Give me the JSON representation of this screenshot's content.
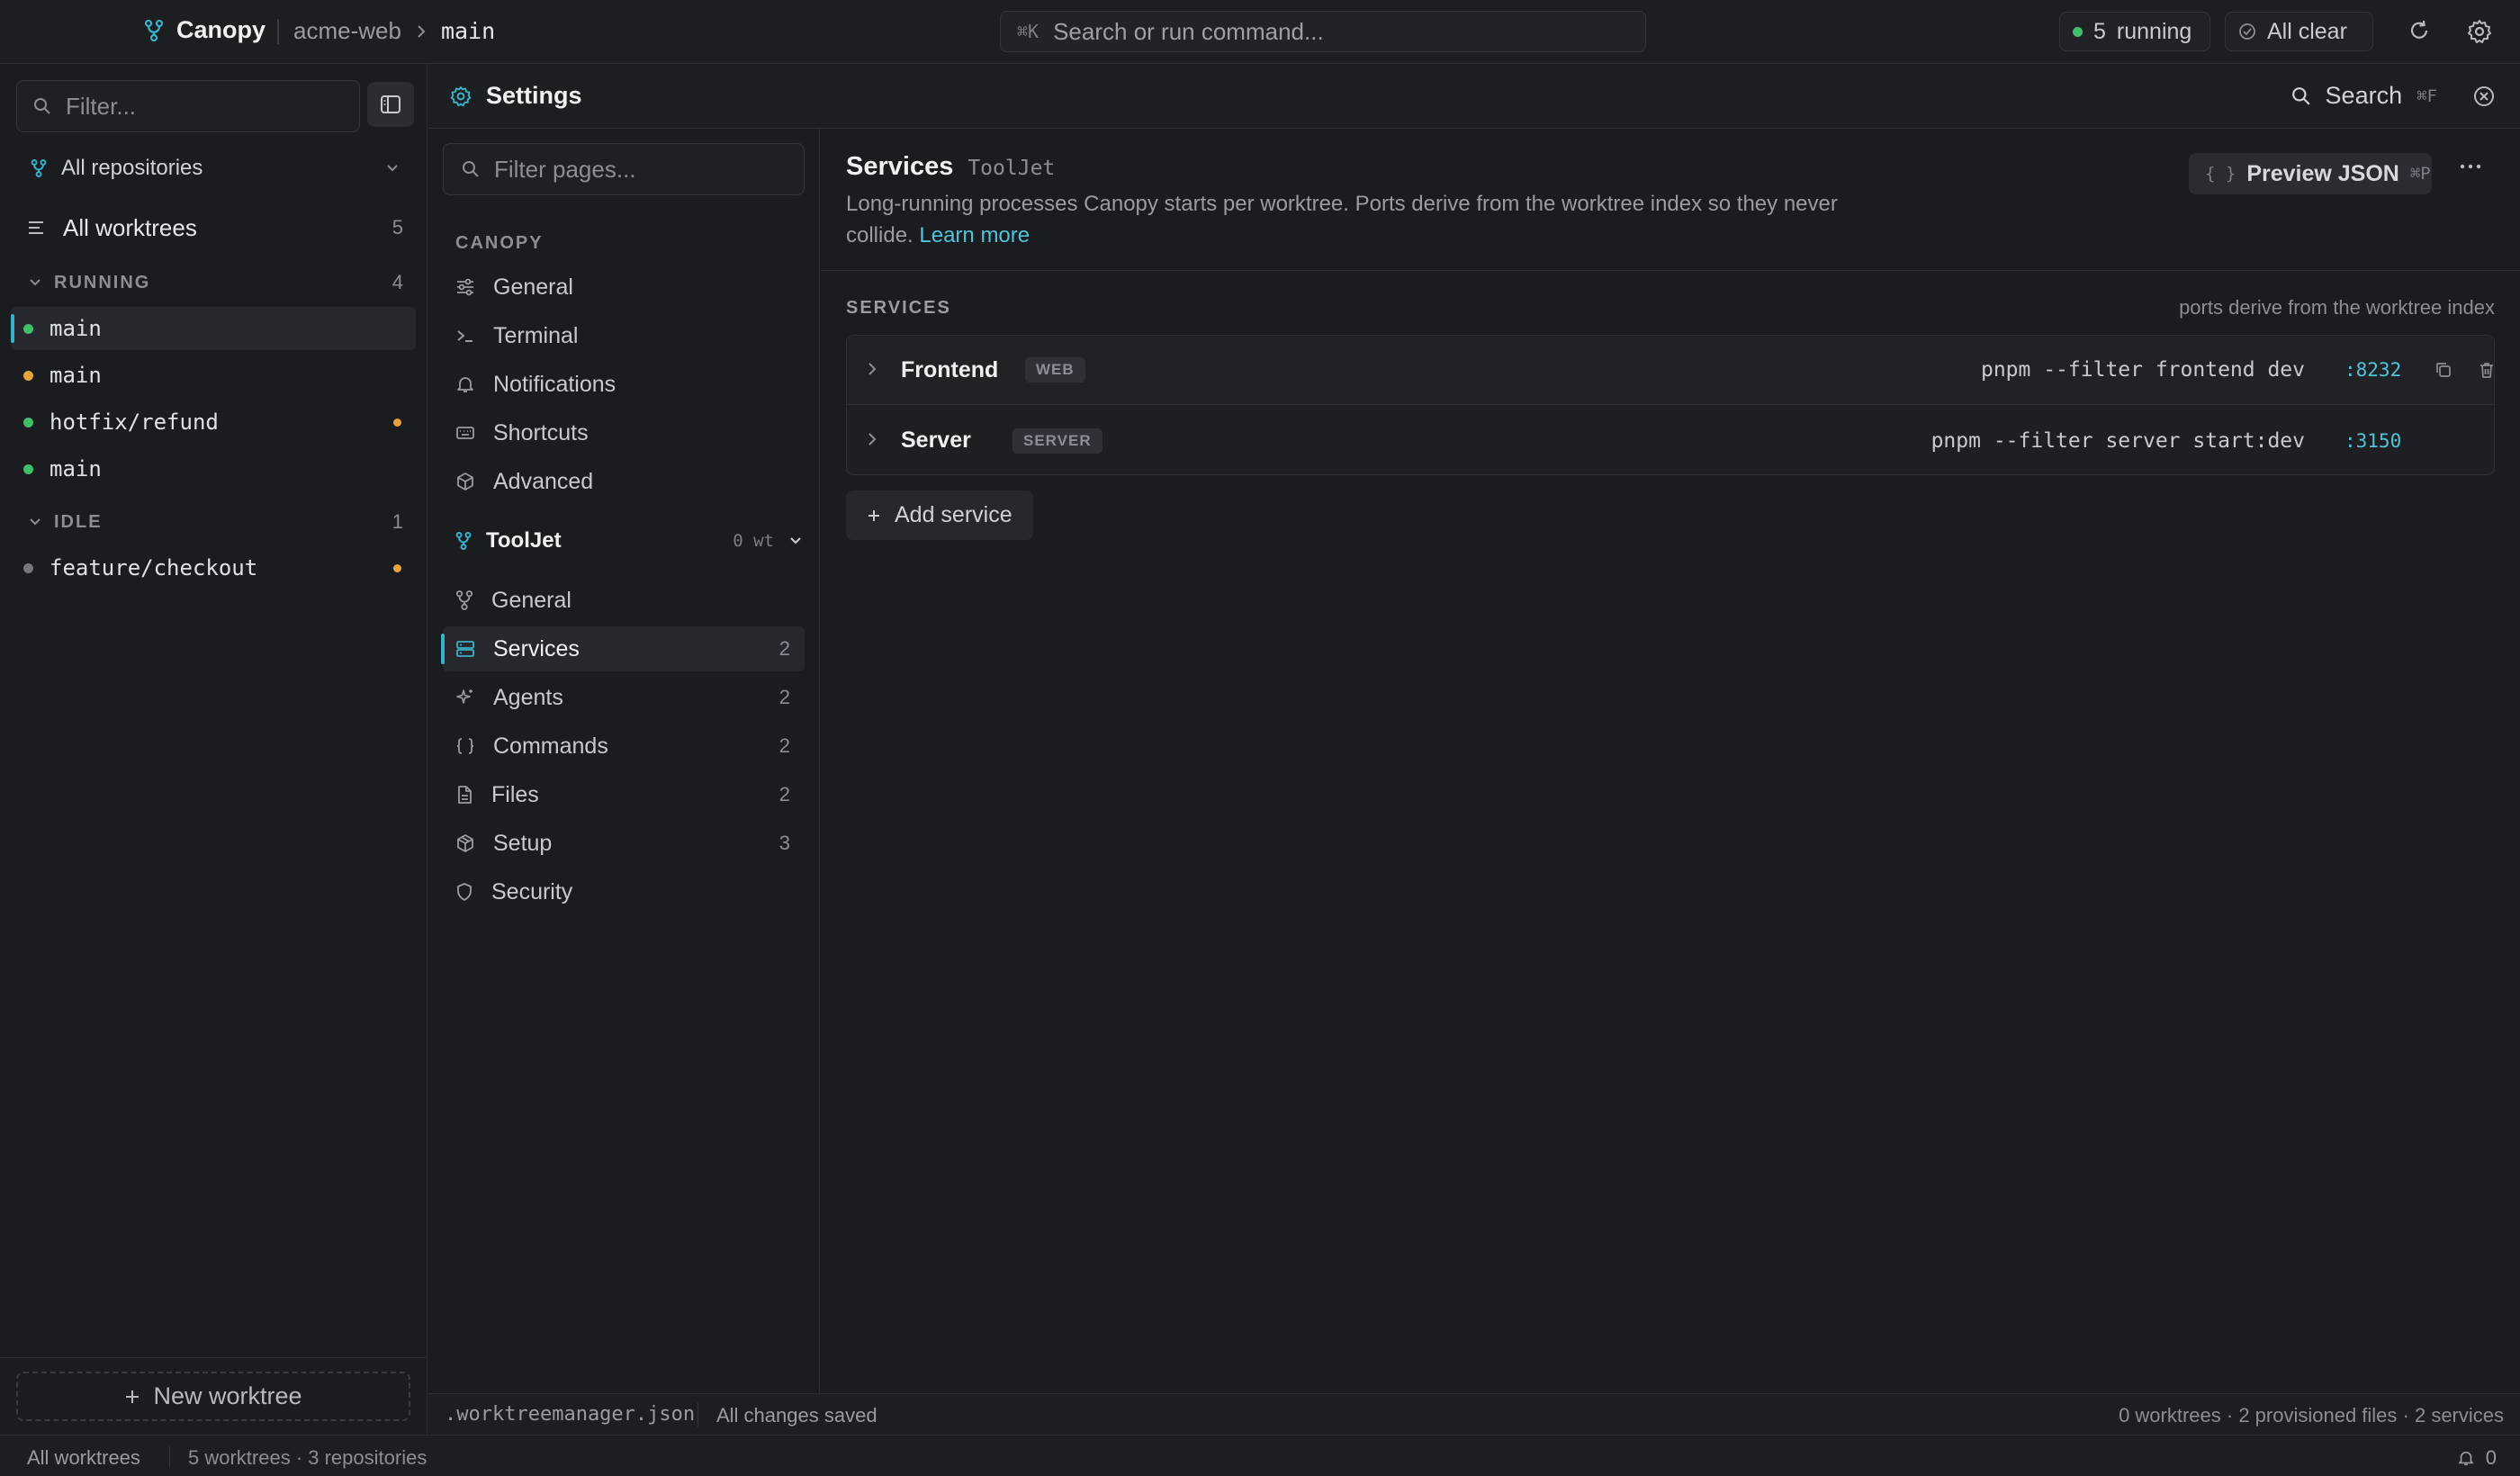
{
  "topbar": {
    "app_name": "Canopy",
    "repo": "acme-web",
    "branch": "main",
    "command_kbd": "⌘K",
    "command_placeholder": "Search or run command...",
    "running_count": "5",
    "running_label": "running",
    "status_label": "All clear"
  },
  "sidebar": {
    "filter_placeholder": "Filter...",
    "repo_select": "All repositories",
    "all_worktrees": {
      "label": "All worktrees",
      "count": "5"
    },
    "groups": [
      {
        "label": "RUNNING",
        "count": "4",
        "items": [
          {
            "label": "main"
          },
          {
            "label": "main"
          },
          {
            "label": "hotfix/refund"
          },
          {
            "label": "main"
          }
        ]
      },
      {
        "label": "IDLE",
        "count": "1",
        "items": [
          {
            "label": "feature/checkout"
          }
        ]
      }
    ],
    "new_worktree": "New worktree"
  },
  "settings": {
    "title": "Settings",
    "search_label": "Search",
    "search_kbd": "⌘F",
    "filter_placeholder": "Filter pages...",
    "section_label": "CANOPY",
    "global_items": [
      {
        "label": "General"
      },
      {
        "label": "Terminal"
      },
      {
        "label": "Notifications"
      },
      {
        "label": "Shortcuts"
      },
      {
        "label": "Advanced"
      }
    ],
    "repo_group": {
      "label": "ToolJet",
      "wt": "0 wt"
    },
    "repo_items": [
      {
        "label": "General",
        "count": ""
      },
      {
        "label": "Services",
        "count": "2"
      },
      {
        "label": "Agents",
        "count": "2"
      },
      {
        "label": "Commands",
        "count": "2"
      },
      {
        "label": "Files",
        "count": "2"
      },
      {
        "label": "Setup",
        "count": "3"
      },
      {
        "label": "Security",
        "count": ""
      }
    ]
  },
  "content": {
    "title": "Services",
    "repo": "ToolJet",
    "description": "Long-running processes Canopy starts per worktree. Ports derive from the worktree index so they never collide.",
    "learn_more": "Learn more",
    "preview_label": "Preview JSON",
    "preview_kbd": "⌘P",
    "section_label": "SERVICES",
    "section_hint": "ports derive from the worktree index",
    "services": [
      {
        "name": "Frontend",
        "badge": "WEB",
        "command": "pnpm --filter frontend dev",
        "port": ":8232"
      },
      {
        "name": "Server",
        "badge": "SERVER",
        "command": "pnpm --filter server start:dev",
        "port": ":3150"
      }
    ],
    "add_service": "Add service"
  },
  "settings_status": {
    "file": ".worktreemanager.json",
    "saved": "All changes saved",
    "summary": "0 worktrees · 2 provisioned files · 2 services"
  },
  "app_status": {
    "left": "All worktrees",
    "middle": "5 worktrees · 3 repositories",
    "notifications": "0"
  },
  "colors": {
    "accent": "#38b2c8",
    "link": "#4fc3d9",
    "running": "#3fbf6a",
    "warning": "#e8a33a"
  }
}
